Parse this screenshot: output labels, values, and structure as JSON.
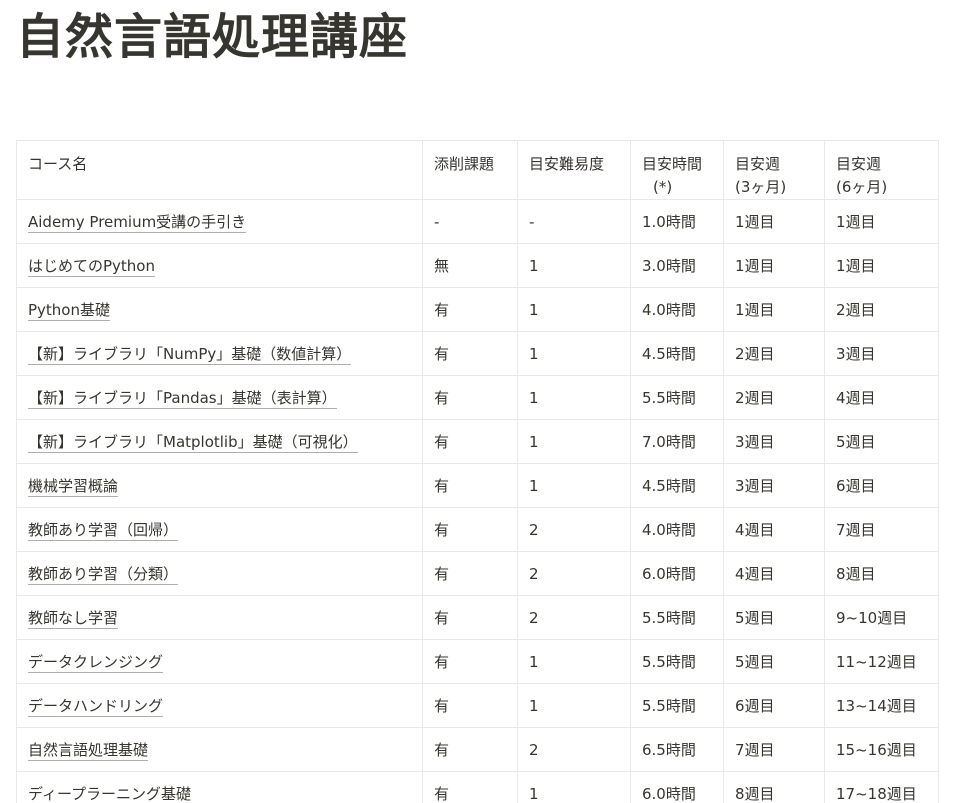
{
  "page": {
    "title": "自然言語処理講座"
  },
  "table": {
    "headers": [
      {
        "lines": [
          "コース名"
        ]
      },
      {
        "lines": [
          "添削課題"
        ]
      },
      {
        "lines": [
          "目安難易度"
        ]
      },
      {
        "lines": [
          "目安時間",
          "(*)"
        ]
      },
      {
        "lines": [
          "目安週",
          "(3ヶ月)"
        ]
      },
      {
        "lines": [
          "目安週",
          "(6ヶ月)"
        ]
      }
    ],
    "rows": [
      {
        "course": "Aidemy Premium受講の手引き",
        "assignment": "-",
        "difficulty": "-",
        "hours": "1.0時間",
        "week3m": "1週目",
        "week6m": "1週目"
      },
      {
        "course": "はじめてのPython",
        "assignment": "無",
        "difficulty": "1",
        "hours": "3.0時間",
        "week3m": "1週目",
        "week6m": "1週目"
      },
      {
        "course": "Python基礎",
        "assignment": "有",
        "difficulty": "1",
        "hours": "4.0時間",
        "week3m": "1週目",
        "week6m": "2週目"
      },
      {
        "course": "【新】ライブラリ「NumPy」基礎（数値計算）",
        "assignment": "有",
        "difficulty": "1",
        "hours": "4.5時間",
        "week3m": "2週目",
        "week6m": "3週目"
      },
      {
        "course": "【新】ライブラリ「Pandas」基礎（表計算）",
        "assignment": "有",
        "difficulty": "1",
        "hours": "5.5時間",
        "week3m": "2週目",
        "week6m": "4週目"
      },
      {
        "course": "【新】ライブラリ「Matplotlib」基礎（可視化）",
        "assignment": "有",
        "difficulty": "1",
        "hours": "7.0時間",
        "week3m": "3週目",
        "week6m": "5週目"
      },
      {
        "course": "機械学習概論",
        "assignment": "有",
        "difficulty": "1",
        "hours": "4.5時間",
        "week3m": "3週目",
        "week6m": "6週目"
      },
      {
        "course": "教師あり学習（回帰）",
        "assignment": "有",
        "difficulty": "2",
        "hours": "4.0時間",
        "week3m": "4週目",
        "week6m": "7週目"
      },
      {
        "course": "教師あり学習（分類）",
        "assignment": "有",
        "difficulty": "2",
        "hours": "6.0時間",
        "week3m": "4週目",
        "week6m": "8週目"
      },
      {
        "course": "教師なし学習",
        "assignment": "有",
        "difficulty": "2",
        "hours": "5.5時間",
        "week3m": "5週目",
        "week6m": "9~10週目"
      },
      {
        "course": "データクレンジング",
        "assignment": "有",
        "difficulty": "1",
        "hours": "5.5時間",
        "week3m": "5週目",
        "week6m": "11~12週目"
      },
      {
        "course": "データハンドリング",
        "assignment": "有",
        "difficulty": "1",
        "hours": "5.5時間",
        "week3m": "6週目",
        "week6m": "13~14週目"
      },
      {
        "course": "自然言語処理基礎",
        "assignment": "有",
        "difficulty": "2",
        "hours": "6.5時間",
        "week3m": "7週目",
        "week6m": "15~16週目"
      },
      {
        "course": "ディープラーニング基礎",
        "assignment": "有",
        "difficulty": "1",
        "hours": "6.0時間",
        "week3m": "8週目",
        "week6m": "17~18週目"
      }
    ]
  }
}
